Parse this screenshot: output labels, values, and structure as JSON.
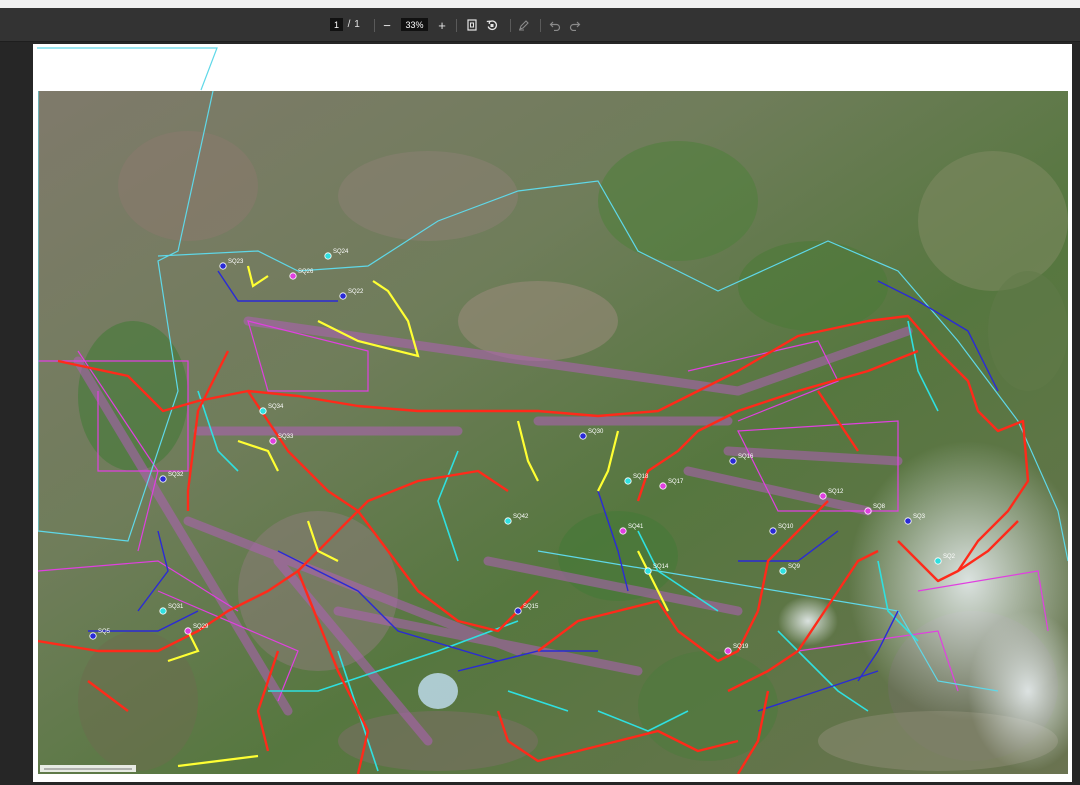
{
  "toolbar": {
    "current_page": "1",
    "page_separator": "/",
    "total_pages": "1",
    "zoom_out_label": "−",
    "zoom_level": "33%",
    "zoom_in_label": "+"
  },
  "map": {
    "labels": [
      "SQ23",
      "SQ24",
      "SQ26",
      "SQ22",
      "SQ34",
      "SQ33",
      "SQ32",
      "SQ42",
      "SQ41",
      "SQ30",
      "SQ18",
      "SQ17",
      "SQ16",
      "SQ31",
      "SQ29",
      "SQ15",
      "SQ14",
      "SQ12",
      "SQ10",
      "SQ9",
      "SQ8",
      "SQ3",
      "SQ2",
      "SQ19",
      "SQ5"
    ]
  },
  "colors": {
    "toolbar_bg": "#333333",
    "viewer_bg": "#262626",
    "pipeline_red": "#ff2a1a",
    "pipeline_yellow": "#ffff33",
    "pipeline_cyan": "#2fe0e0",
    "pipeline_blue": "#2a2ad6",
    "parcel_magenta": "#e040e0",
    "boundary_cyan": "#5fd8e8"
  }
}
